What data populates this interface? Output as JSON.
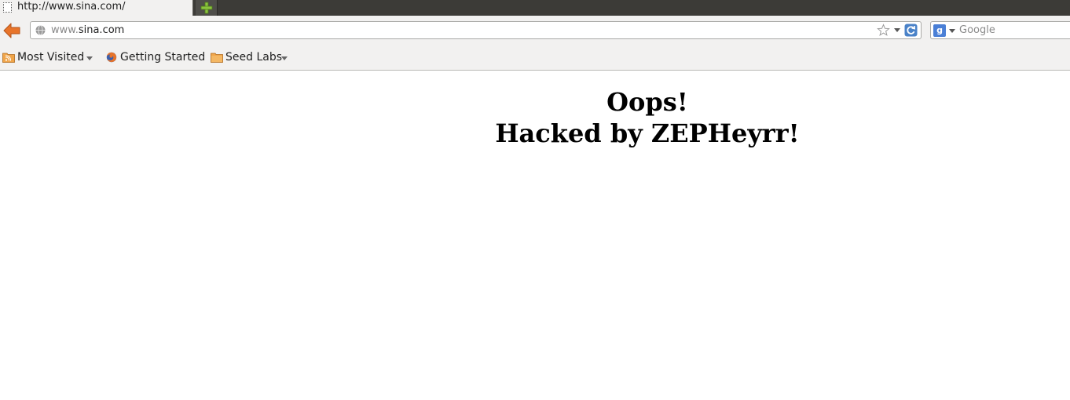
{
  "tabs": [
    {
      "title": "http://www.sina.com/"
    }
  ],
  "navbar": {
    "url_prefix": "www.",
    "url_host": "sina.com",
    "search_placeholder": "Google"
  },
  "bookmarks": [
    {
      "label": "Most Visited",
      "has_dropdown": true
    },
    {
      "label": "Getting Started",
      "has_dropdown": false
    },
    {
      "label": "Seed Labs",
      "has_dropdown": true
    }
  ],
  "page": {
    "line1": "Oops!",
    "line2": "Hacked by ZEPHeyrr!"
  },
  "colors": {
    "tabstrip_bg": "#3c3b37",
    "toolbar_bg": "#f2f1f0",
    "back_arrow": "#e8742a",
    "newtab_plus": "#8ac33d"
  }
}
